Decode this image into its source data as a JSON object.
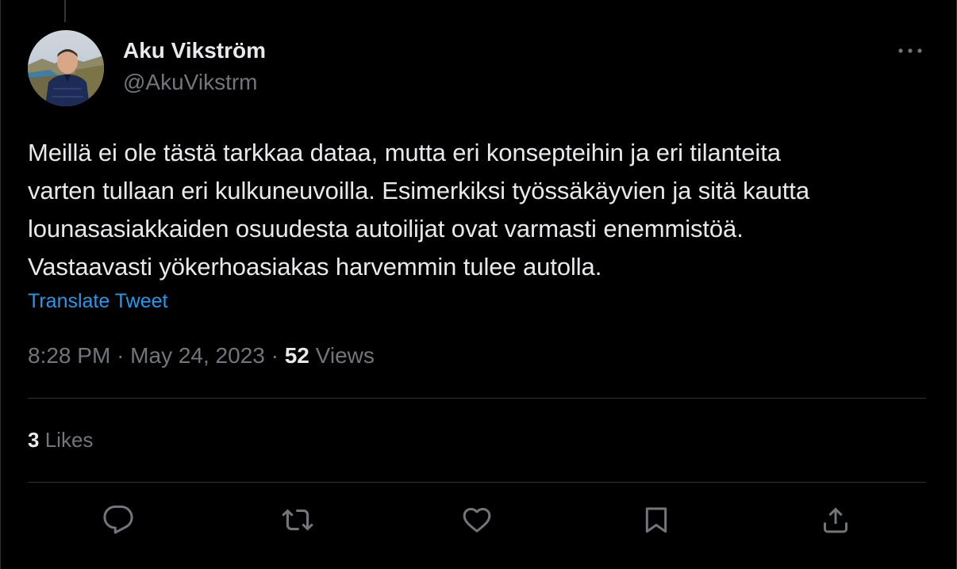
{
  "author": {
    "display_name": "Aku Vikström",
    "handle": "@AkuVikstrm"
  },
  "tweet": {
    "text_lines": [
      "Meillä ei ole tästä tarkkaa dataa, mutta eri konsepteihin ja eri tilanteita",
      "varten tullaan eri kulkuneuvoilla. Esimerkiksi työssäkäyvien ja sitä kautta",
      "lounasasiakkaiden osuudesta autoilijat ovat varmasti enemmistöä.",
      "Vastaavasti yökerhoasiakas harvemmin tulee autolla."
    ],
    "translate_label": "Translate Tweet",
    "time": "8:28 PM",
    "date": "May 24, 2023",
    "separator": "·",
    "views_count": "52",
    "views_label": "Views"
  },
  "stats": {
    "likes_count": "3",
    "likes_label": "Likes"
  },
  "actions": {
    "icons": [
      "reply-icon",
      "retweet-icon",
      "like-icon",
      "bookmark-icon",
      "share-icon"
    ]
  },
  "colors": {
    "background": "#000000",
    "text": "#e7e9ea",
    "muted": "#71767b",
    "link": "#1d9bf0",
    "divider": "#2f3336"
  }
}
